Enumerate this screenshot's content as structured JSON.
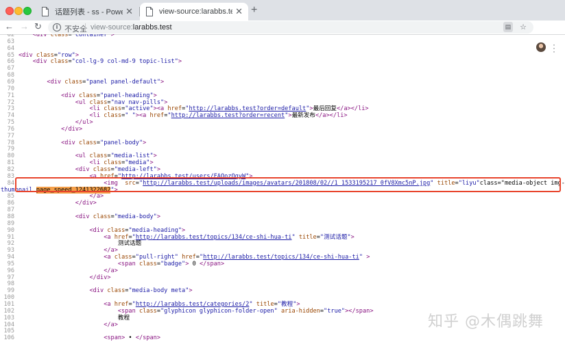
{
  "window": {
    "tabs": [
      {
        "title": "话题列表 - ss - Powered by La",
        "active": false
      },
      {
        "title": "view-source:larabbs.test",
        "active": true
      }
    ],
    "new_tab_label": "+"
  },
  "toolbar": {
    "insecure_label": "不安全",
    "url_scheme": "view-source:",
    "url_host": "larabbs.test"
  },
  "source": {
    "lines": [
      {
        "n": "62",
        "code": "    <div class=\"container\">"
      },
      {
        "n": "63",
        "code": ""
      },
      {
        "n": "64",
        "code": ""
      },
      {
        "n": "65",
        "code": "<div class=\"row\">"
      },
      {
        "n": "66",
        "code": "    <div class=\"col-lg-9 col-md-9 topic-list\">"
      },
      {
        "n": "67",
        "code": ""
      },
      {
        "n": "68",
        "code": ""
      },
      {
        "n": "69",
        "code": "        <div class=\"panel panel-default\">"
      },
      {
        "n": "70",
        "code": ""
      },
      {
        "n": "71",
        "code": "            <div class=\"panel-heading\">"
      },
      {
        "n": "72",
        "code": "                <ul class=\"nav nav-pills\">"
      },
      {
        "n": "73",
        "code": "                    <li class=\"active\"><a href=\"http://larabbs.test?order=default\">最后回复</a></li>"
      },
      {
        "n": "74",
        "code": "                    <li class=\" \"><a href=\"http://larabbs.test?order=recent\">最新发布</a></li>"
      },
      {
        "n": "75",
        "code": "                </ul>"
      },
      {
        "n": "76",
        "code": "            </div>"
      },
      {
        "n": "77",
        "code": ""
      },
      {
        "n": "78",
        "code": "            <div class=\"panel-body\">"
      },
      {
        "n": "79",
        "code": ""
      },
      {
        "n": "80",
        "code": "                <ul class=\"media-list\">"
      },
      {
        "n": "81",
        "code": "                    <li class=\"media\">"
      },
      {
        "n": "82",
        "code": "                <div class=\"media-left\">"
      },
      {
        "n": "83",
        "code": "                    <a href=\"http://larabbs.test/users/FAQozOqyW\">"
      },
      {
        "n": "84",
        "code": "                        <img  src=\"http://larabbs.test/uploads/images/avatars/201808/02//1_1533195217_0fV8Xmc5nP.jpg\" title=\"liyu\"class=\"media-object img-"
      },
      {
        "n": "",
        "code": "thumbnail page_speed_1241322682\">"
      },
      {
        "n": "85",
        "code": "                    </a>"
      },
      {
        "n": "86",
        "code": "                </div>"
      },
      {
        "n": "87",
        "code": ""
      },
      {
        "n": "88",
        "code": "                <div class=\"media-body\">"
      },
      {
        "n": "89",
        "code": ""
      },
      {
        "n": "90",
        "code": "                    <div class=\"media-heading\">"
      },
      {
        "n": "91",
        "code": "                        <a href=\"http://larabbs.test/topics/134/ce-shi-hua-ti\" title=\"测试话题\">"
      },
      {
        "n": "92",
        "code": "                            测试话题"
      },
      {
        "n": "93",
        "code": "                        </a>"
      },
      {
        "n": "94",
        "code": "                        <a class=\"pull-right\" href=\"http://larabbs.test/topics/134/ce-shi-hua-ti\" >"
      },
      {
        "n": "95",
        "code": "                            <span class=\"badge\"> 0 </span>"
      },
      {
        "n": "96",
        "code": "                        </a>"
      },
      {
        "n": "97",
        "code": "                    </div>"
      },
      {
        "n": "98",
        "code": ""
      },
      {
        "n": "99",
        "code": "                    <div class=\"media-body meta\">"
      },
      {
        "n": "100",
        "code": ""
      },
      {
        "n": "101",
        "code": "                        <a href=\"http://larabbs.test/categories/2\" title=\"教程\">"
      },
      {
        "n": "102",
        "code": "                            <span class=\"glyphicon glyphicon-folder-open\" aria-hidden=\"true\"></span>"
      },
      {
        "n": "103",
        "code": "                            教程"
      },
      {
        "n": "104",
        "code": "                        </a>"
      },
      {
        "n": "105",
        "code": ""
      },
      {
        "n": "106",
        "code": "                        <span> • </span>"
      }
    ],
    "highlighted_class": "page_speed_1241322682"
  },
  "watermark": "知乎 @木偶跳舞",
  "icons": {
    "back": "arrow-left-icon",
    "forward": "arrow-right-icon",
    "reload": "reload-icon",
    "info": "info-icon",
    "page": "page-icon",
    "star": "star-icon",
    "avatar": "avatar",
    "menu": "more-vert-icon"
  },
  "colors": {
    "tag": "#881280",
    "attr": "#994500",
    "value": "#1a1aa6",
    "highlight": "#f5a04a",
    "box": "#e8442c"
  }
}
